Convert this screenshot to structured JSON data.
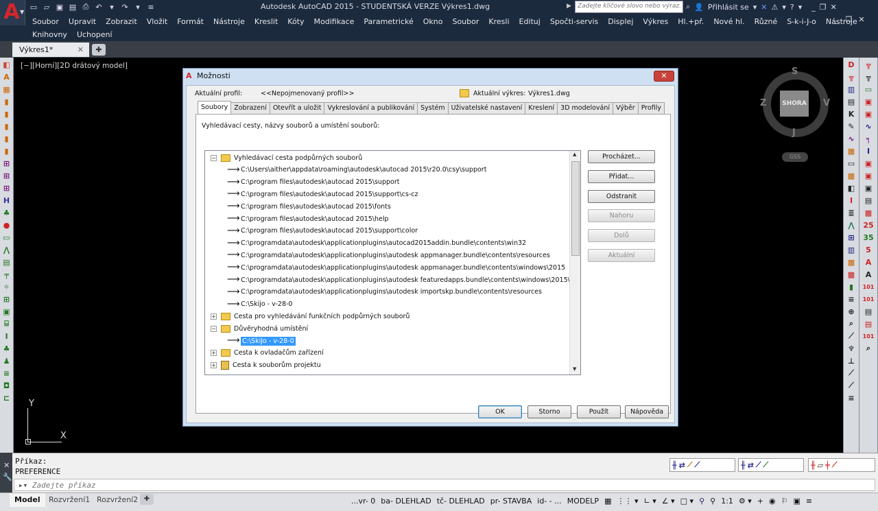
{
  "app": {
    "title": "Autodesk AutoCAD 2015 - STUDENTSKÁ VERZE    Výkres1.dwg",
    "search_placeholder": "Zadejte klíčové slovo nebo výraz.",
    "login": "Přihlásit se",
    "menus": [
      "Soubor",
      "Upravit",
      "Zobrazit",
      "Vložit",
      "Formát",
      "Nástroje",
      "Kreslit",
      "Kóty",
      "Modifikace",
      "Parametrické",
      "Okno",
      "Soubor",
      "Kresli",
      "Edituj",
      "Spočti-servis",
      "Displej",
      "Výkres",
      "Hl.+př.",
      "Nové hl.",
      "Různé",
      "S-k-i-J-o",
      "Nástroje"
    ],
    "menus2": [
      "Knihovny",
      "Uchopení"
    ],
    "doc_tab": "Výkres1*",
    "viewport_label": "[−][Horní][2D drátový model]",
    "accent": "#d4262b"
  },
  "viewcube": {
    "top": "S",
    "bottom": "J",
    "left": "Z",
    "right": "V",
    "face": "SHORA",
    "wcs": "GSS"
  },
  "ucs": {
    "x": "X",
    "y": "Y"
  },
  "commandline": {
    "history": [
      "Příkaz:",
      "PREFERENCE"
    ],
    "placeholder": "Zadejte příkaz"
  },
  "statusbar": {
    "layout_tabs": [
      "Model",
      "Rozvržení1",
      "Rozvržení2"
    ],
    "items": [
      "...vr- 0",
      "ba- DLEHLAD",
      "tč- DLEHLAD",
      "pr- STAVBA",
      "id- - ...",
      "MODELP",
      "1:1"
    ]
  },
  "dialog": {
    "title": "Možnosti",
    "close": "✕",
    "profile_label": "Aktuální profil:",
    "profile_value": "<<Nepojmenovaný profil>>",
    "drawing_label": "Aktuální výkres:",
    "drawing_value": "Výkres1.dwg",
    "tabs": [
      "Soubory",
      "Zobrazení",
      "Otevřít a uložit",
      "Vykreslování a publikování",
      "Systém",
      "Uživatelské nastavení",
      "Kreslení",
      "3D modelování",
      "Výběr",
      "Profily"
    ],
    "tree_label": "Vyhledávací cesty, názvy souborů a umístění souborů:",
    "tree": [
      {
        "level": 0,
        "kind": "folder-open",
        "exp": "−",
        "text": "Vyhledávací cesta podpůrných souborů"
      },
      {
        "level": 1,
        "kind": "path",
        "text": "C:\\Users\\aither\\appdata\\roaming\\autodesk\\autocad 2015\\r20.0\\csy\\support"
      },
      {
        "level": 1,
        "kind": "path",
        "text": "C:\\program files\\autodesk\\autocad 2015\\support"
      },
      {
        "level": 1,
        "kind": "path",
        "text": "C:\\program files\\autodesk\\autocad 2015\\support\\cs-cz"
      },
      {
        "level": 1,
        "kind": "path",
        "text": "C:\\program files\\autodesk\\autocad 2015\\fonts"
      },
      {
        "level": 1,
        "kind": "path",
        "text": "C:\\program files\\autodesk\\autocad 2015\\help"
      },
      {
        "level": 1,
        "kind": "path",
        "text": "C:\\program files\\autodesk\\autocad 2015\\support\\color"
      },
      {
        "level": 1,
        "kind": "path",
        "text": "C:\\programdata\\autodesk\\applicationplugins\\autocad2015addin.bundle\\contents\\win32"
      },
      {
        "level": 1,
        "kind": "path",
        "text": "C:\\programdata\\autodesk\\applicationplugins\\autodesk appmanager.bundle\\contents\\resources"
      },
      {
        "level": 1,
        "kind": "path",
        "text": "C:\\programdata\\autodesk\\applicationplugins\\autodesk appmanager.bundle\\contents\\windows\\2015"
      },
      {
        "level": 1,
        "kind": "path",
        "text": "C:\\programdata\\autodesk\\applicationplugins\\autodesk featuredapps.bundle\\contents\\windows\\2015\\win32"
      },
      {
        "level": 1,
        "kind": "path",
        "text": "C:\\programdata\\autodesk\\applicationplugins\\autodesk importskp.bundle\\contents\\resources"
      },
      {
        "level": 1,
        "kind": "path",
        "text": "C:\\Skijo - v-28-0"
      },
      {
        "level": 0,
        "kind": "folder",
        "exp": "+",
        "text": "Cesta pro vyhledávání funkčních podpůrných souborů"
      },
      {
        "level": 0,
        "kind": "folder-open",
        "exp": "−",
        "text": "Důvěryhodná umístění"
      },
      {
        "level": 1,
        "kind": "path",
        "text": "C:\\SkiJo - v-28-0",
        "selected": true
      },
      {
        "level": 0,
        "kind": "folder",
        "exp": "+",
        "text": "Cesta k ovladačům zařízení"
      },
      {
        "level": 0,
        "kind": "project",
        "exp": "+",
        "text": "Cesta k souborům projektu"
      }
    ],
    "side_buttons": [
      {
        "label": "Procházet...",
        "enabled": true
      },
      {
        "label": "Přidat...",
        "enabled": true
      },
      {
        "label": "Odstranit",
        "enabled": true
      },
      {
        "label": "Nahoru",
        "enabled": false
      },
      {
        "label": "Dolů",
        "enabled": false
      },
      {
        "label": "Aktuální",
        "enabled": false
      }
    ],
    "footer_buttons": [
      "OK",
      "Storno",
      "Použít",
      "Nápověda"
    ]
  },
  "toolbar_left": [
    {
      "icon": "layer-icon",
      "glyph": "◧",
      "color": "#c43"
    },
    {
      "icon": "text-style-icon",
      "glyph": "A",
      "color": "#c60"
    },
    {
      "icon": "block-icon",
      "glyph": "▦",
      "color": "#c60"
    },
    {
      "icon": "fill-icon",
      "glyph": "▮",
      "color": "#c60"
    },
    {
      "icon": "fill-icon",
      "glyph": "▮",
      "color": "#c60"
    },
    {
      "icon": "fill-icon",
      "glyph": "▮",
      "color": "#c60"
    },
    {
      "icon": "fill-icon",
      "glyph": "▮",
      "color": "#c60"
    },
    {
      "icon": "fill-icon",
      "glyph": "▮",
      "color": "#c60"
    },
    {
      "icon": "grid-icon",
      "glyph": "⊞",
      "color": "#717"
    },
    {
      "icon": "grid-icon",
      "glyph": "⊞",
      "color": "#717"
    },
    {
      "icon": "grid-icon",
      "glyph": "⊞",
      "color": "#717"
    },
    {
      "icon": "hu-icon",
      "glyph": "H",
      "color": "#339"
    },
    {
      "icon": "tree-icon",
      "glyph": "♣",
      "color": "#272"
    },
    {
      "icon": "stop-icon",
      "glyph": "●",
      "color": "#c22"
    },
    {
      "icon": "rect-icon",
      "glyph": "▭",
      "color": "#272"
    },
    {
      "icon": "measure-icon",
      "glyph": "⋀",
      "color": "#272"
    },
    {
      "icon": "table-icon",
      "glyph": "▤",
      "color": "#272"
    },
    {
      "icon": "rail-icon",
      "glyph": "╤",
      "color": "#272"
    },
    {
      "icon": "star-icon",
      "glyph": "✧",
      "color": "#272"
    },
    {
      "icon": "grid-icon",
      "glyph": "⊞",
      "color": "#272"
    },
    {
      "icon": "box-icon",
      "glyph": "▣",
      "color": "#272"
    },
    {
      "icon": "bracket-icon",
      "glyph": "⌸",
      "color": "#272"
    },
    {
      "icon": "column-icon",
      "glyph": "I",
      "color": "#272"
    },
    {
      "icon": "tree-icon",
      "glyph": "♣",
      "color": "#272"
    },
    {
      "icon": "figure-icon",
      "glyph": "♟",
      "color": "#272"
    },
    {
      "icon": "lines-icon",
      "glyph": "≡",
      "color": "#272"
    },
    {
      "icon": "square-icon",
      "glyph": "◘",
      "color": "#272"
    },
    {
      "icon": "dim-icon",
      "glyph": "⊏",
      "color": "#272"
    }
  ],
  "toolbar_right1": [
    {
      "icon": "d-icon",
      "glyph": "D",
      "color": "#c22"
    },
    {
      "icon": "align-icon",
      "glyph": "╦",
      "color": "#c22"
    },
    {
      "icon": "copy-icon",
      "glyph": "▥",
      "color": "#228"
    },
    {
      "icon": "table-icon",
      "glyph": "▤",
      "color": "#222"
    },
    {
      "icon": "kt-icon",
      "glyph": "K",
      "color": "#222"
    },
    {
      "icon": "pen-icon",
      "glyph": "✎",
      "color": "#222"
    },
    {
      "icon": "wave-icon",
      "glyph": "∿",
      "color": "#717"
    },
    {
      "icon": "hatch-icon",
      "glyph": "▩",
      "color": "#c60"
    },
    {
      "icon": "rect-icon",
      "glyph": "▭",
      "color": "#222"
    },
    {
      "icon": "hatch-icon",
      "glyph": "▩",
      "color": "#c60"
    },
    {
      "icon": "copy-icon",
      "glyph": "◧",
      "color": "#222"
    },
    {
      "icon": "column-icon",
      "glyph": "I",
      "color": "#c22"
    },
    {
      "icon": "lines-icon",
      "glyph": "≣",
      "color": "#222"
    },
    {
      "icon": "triangle-icon",
      "glyph": "⋀",
      "color": "#275"
    },
    {
      "icon": "grid-icon",
      "glyph": "⊞",
      "color": "#228"
    },
    {
      "icon": "copy-icon",
      "glyph": "▥",
      "color": "#228"
    },
    {
      "icon": "hatch-icon",
      "glyph": "▩",
      "color": "#c60"
    },
    {
      "icon": "hatch-icon",
      "glyph": "▩",
      "color": "#c22"
    },
    {
      "icon": "book-icon",
      "glyph": "▮",
      "color": "#272"
    },
    {
      "icon": "lines-icon",
      "glyph": "≡",
      "color": "#222"
    },
    {
      "icon": "target-icon",
      "glyph": "⊕",
      "color": "#222"
    },
    {
      "icon": "search-icon",
      "glyph": "⌕",
      "color": "#222"
    },
    {
      "icon": "line-icon",
      "glyph": "⟋",
      "color": "#222"
    },
    {
      "icon": "lamp-icon",
      "glyph": "♆",
      "color": "#222"
    },
    {
      "icon": "dim-icon",
      "glyph": "⊥",
      "color": "#222"
    },
    {
      "icon": "line-icon",
      "glyph": "⟋",
      "color": "#222"
    },
    {
      "icon": "line-icon",
      "glyph": "⟋",
      "color": "#222"
    },
    {
      "icon": "lines-icon",
      "glyph": "≡",
      "color": "#222"
    }
  ],
  "toolbar_right2": [
    {
      "icon": "align-icon",
      "glyph": "╦",
      "color": "#c22"
    },
    {
      "icon": "align-icon",
      "glyph": "╦",
      "color": "#222"
    },
    {
      "icon": "rect-icon",
      "glyph": "▭",
      "color": "#272"
    },
    {
      "icon": "box-icon",
      "glyph": "▣",
      "color": "#c22"
    },
    {
      "icon": "box-icon",
      "glyph": "▣",
      "color": "#c22"
    },
    {
      "icon": "wave-icon",
      "glyph": "∿",
      "color": "#228"
    },
    {
      "icon": "align-icon",
      "glyph": "╕",
      "color": "#717"
    },
    {
      "icon": "column-icon",
      "glyph": "I",
      "color": "#228"
    },
    {
      "icon": "box-icon",
      "glyph": "▣",
      "color": "#c22"
    },
    {
      "icon": "box-icon",
      "glyph": "▣",
      "color": "#c22"
    },
    {
      "icon": "box-icon",
      "glyph": "▣",
      "color": "#222"
    },
    {
      "icon": "table-icon",
      "glyph": "▤",
      "color": "#222"
    },
    {
      "icon": "hatch-icon",
      "glyph": "▩",
      "color": "#c22"
    },
    {
      "icon": "n25-icon",
      "glyph": "25",
      "color": "#c22"
    },
    {
      "icon": "n35-icon",
      "glyph": "35",
      "color": "#272"
    },
    {
      "icon": "n5-icon",
      "glyph": "5",
      "color": "#c22"
    },
    {
      "icon": "text-a-icon",
      "glyph": "A",
      "color": "#c22"
    },
    {
      "icon": "text-a-icon",
      "glyph": "A",
      "color": "#222"
    },
    {
      "icon": "n101-icon",
      "glyph": "101",
      "color": "#c22"
    },
    {
      "icon": "n101-icon",
      "glyph": "101",
      "color": "#c22"
    },
    {
      "icon": "table-icon",
      "glyph": "▤",
      "color": "#222"
    },
    {
      "icon": "table-icon",
      "glyph": "▤",
      "color": "#c22"
    },
    {
      "icon": "n101-icon",
      "glyph": "101",
      "color": "#c22"
    },
    {
      "icon": "search-icon",
      "glyph": "⌕",
      "color": "#222"
    }
  ]
}
